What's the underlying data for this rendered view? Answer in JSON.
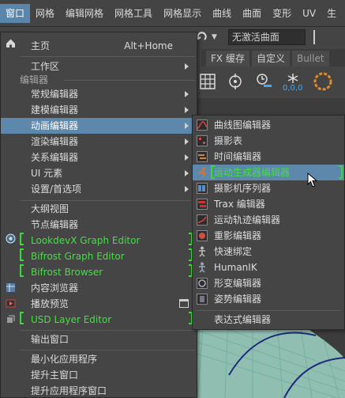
{
  "menubar": {
    "items": [
      "窗口",
      "网格",
      "编辑网格",
      "网格工具",
      "网格显示",
      "曲线",
      "曲面",
      "变形",
      "UV",
      "生"
    ]
  },
  "background": {
    "dropdown_value": "无激活曲面",
    "shelf_tabs": [
      "FX 缓存",
      "自定义",
      "Bullet"
    ],
    "shelf_label": "0,0,0"
  },
  "menu": {
    "home": "主页",
    "home_shortcut": "Alt+Home",
    "workspace": "工作区",
    "editors_section": "编辑器",
    "general_editors": "常规编辑器",
    "modeling_editors": "建模编辑器",
    "animation_editors": "动画编辑器",
    "rendering_editors": "渲染编辑器",
    "relationship_editors": "关系编辑器",
    "ui_elements": "UI 元素",
    "settings_preferences": "设置/首选项",
    "outliner": "大纲视图",
    "node_editor": "节点编辑器",
    "lookdevx": "LookdevX Graph Editor",
    "bifrost_graph": "Bifrost Graph Editor",
    "bifrost_browser": "Bifrost Browser",
    "content_browser": "内容浏览器",
    "playblast": "播放预览",
    "usd_layer": "USD Layer Editor",
    "output_window": "输出窗口",
    "minimize_app": "最小化应用程序",
    "raise_main": "提升主窗口",
    "raise_app": "提升应用程序窗口"
  },
  "submenu": {
    "items": [
      "曲线图编辑器",
      "摄影表",
      "时间编辑器",
      "运动生成器编辑器",
      "摄影机序列器",
      "Trax 编辑器",
      "运动轨迹编辑器",
      "重影编辑器",
      "快速绑定",
      "HumanIK",
      "形变编辑器",
      "姿势编辑器",
      "表达式编辑器"
    ]
  },
  "colors": {
    "highlight": "#5e87ac",
    "annotation_green": "#30e030",
    "menu_bg": "#454545"
  }
}
